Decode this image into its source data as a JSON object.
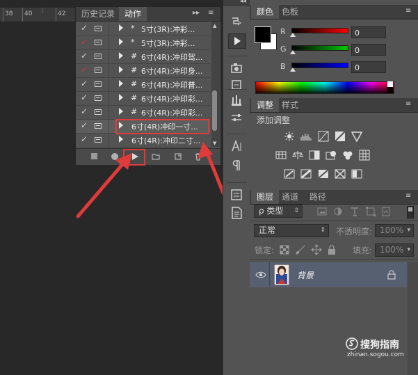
{
  "ruler": {
    "marks": [
      "38",
      "40",
      "42"
    ]
  },
  "actions_panel": {
    "tabs": [
      {
        "label": "历史记录"
      },
      {
        "label": "动作"
      }
    ],
    "menu": "▸▸",
    "rows": [
      {
        "check": "✓",
        "check_red": false,
        "marker": "*",
        "label": "5寸(3R):冲彩..."
      },
      {
        "check": "✓",
        "check_red": true,
        "marker": "*",
        "label": "5寸(3R):冲彩..."
      },
      {
        "check": "✓",
        "check_red": false,
        "marker": "#",
        "label": "6寸(4R):冲印驾..."
      },
      {
        "check": "✓",
        "check_red": true,
        "marker": "#",
        "label": "6寸(4R):冲印身..."
      },
      {
        "check": "✓",
        "check_red": false,
        "marker": "#",
        "label": "6寸(4R):冲印普..."
      },
      {
        "check": "✓",
        "check_red": false,
        "marker": "#",
        "label": "6寸(4R):冲印彩..."
      },
      {
        "check": "✓",
        "check_red": false,
        "marker": "#",
        "label": "6寸(4R):冲印彩..."
      },
      {
        "check": "✓",
        "check_red": false,
        "marker": "",
        "label": "6寸(4R)冲印一寸..."
      },
      {
        "check": "✓",
        "check_red": false,
        "marker": "",
        "label": "6寸(4R):冲印二寸..."
      }
    ]
  },
  "color_panel": {
    "tabs": [
      {
        "label": "颜色"
      },
      {
        "label": "色板"
      }
    ],
    "channels": [
      {
        "name": "R",
        "value": "0",
        "color": "#ff0000"
      },
      {
        "name": "G",
        "value": "0",
        "color": "#00c800"
      },
      {
        "name": "B",
        "value": "0",
        "color": "#0000ff"
      }
    ]
  },
  "adjust_panel": {
    "tabs": [
      {
        "label": "调整"
      },
      {
        "label": "样式"
      }
    ],
    "title": "添加调整"
  },
  "layers_panel": {
    "tabs": [
      {
        "label": "图层"
      },
      {
        "label": "通道"
      },
      {
        "label": "路径"
      }
    ],
    "filter_type": "ρ 类型",
    "blend_mode": "正常",
    "opacity_label": "不透明度:",
    "opacity_value": "100%",
    "lock_label": "锁定:",
    "fill_label": "填充:",
    "fill_value": "100%",
    "layers": [
      {
        "name": "背景",
        "locked": true
      }
    ]
  },
  "watermark": {
    "brand": "搜狗指南",
    "url": "zhinan.sogou.com"
  }
}
